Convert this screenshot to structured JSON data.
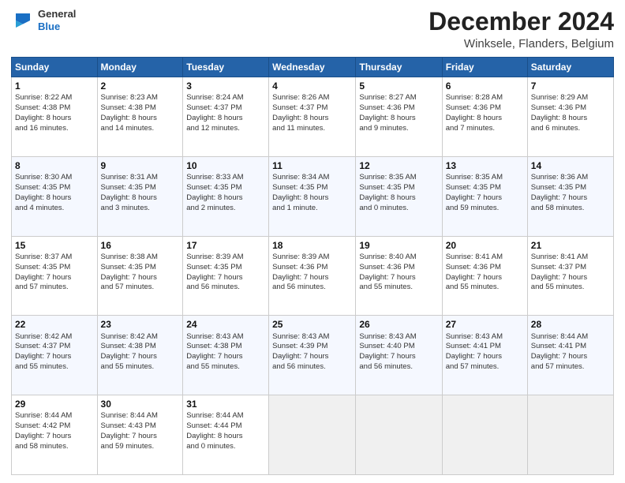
{
  "header": {
    "logo_line1": "General",
    "logo_line2": "Blue",
    "month": "December 2024",
    "location": "Winksele, Flanders, Belgium"
  },
  "days_of_week": [
    "Sunday",
    "Monday",
    "Tuesday",
    "Wednesday",
    "Thursday",
    "Friday",
    "Saturday"
  ],
  "weeks": [
    [
      {
        "num": "1",
        "lines": [
          "Sunrise: 8:22 AM",
          "Sunset: 4:38 PM",
          "Daylight: 8 hours",
          "and 16 minutes."
        ]
      },
      {
        "num": "2",
        "lines": [
          "Sunrise: 8:23 AM",
          "Sunset: 4:38 PM",
          "Daylight: 8 hours",
          "and 14 minutes."
        ]
      },
      {
        "num": "3",
        "lines": [
          "Sunrise: 8:24 AM",
          "Sunset: 4:37 PM",
          "Daylight: 8 hours",
          "and 12 minutes."
        ]
      },
      {
        "num": "4",
        "lines": [
          "Sunrise: 8:26 AM",
          "Sunset: 4:37 PM",
          "Daylight: 8 hours",
          "and 11 minutes."
        ]
      },
      {
        "num": "5",
        "lines": [
          "Sunrise: 8:27 AM",
          "Sunset: 4:36 PM",
          "Daylight: 8 hours",
          "and 9 minutes."
        ]
      },
      {
        "num": "6",
        "lines": [
          "Sunrise: 8:28 AM",
          "Sunset: 4:36 PM",
          "Daylight: 8 hours",
          "and 7 minutes."
        ]
      },
      {
        "num": "7",
        "lines": [
          "Sunrise: 8:29 AM",
          "Sunset: 4:36 PM",
          "Daylight: 8 hours",
          "and 6 minutes."
        ]
      }
    ],
    [
      {
        "num": "8",
        "lines": [
          "Sunrise: 8:30 AM",
          "Sunset: 4:35 PM",
          "Daylight: 8 hours",
          "and 4 minutes."
        ]
      },
      {
        "num": "9",
        "lines": [
          "Sunrise: 8:31 AM",
          "Sunset: 4:35 PM",
          "Daylight: 8 hours",
          "and 3 minutes."
        ]
      },
      {
        "num": "10",
        "lines": [
          "Sunrise: 8:33 AM",
          "Sunset: 4:35 PM",
          "Daylight: 8 hours",
          "and 2 minutes."
        ]
      },
      {
        "num": "11",
        "lines": [
          "Sunrise: 8:34 AM",
          "Sunset: 4:35 PM",
          "Daylight: 8 hours",
          "and 1 minute."
        ]
      },
      {
        "num": "12",
        "lines": [
          "Sunrise: 8:35 AM",
          "Sunset: 4:35 PM",
          "Daylight: 8 hours",
          "and 0 minutes."
        ]
      },
      {
        "num": "13",
        "lines": [
          "Sunrise: 8:35 AM",
          "Sunset: 4:35 PM",
          "Daylight: 7 hours",
          "and 59 minutes."
        ]
      },
      {
        "num": "14",
        "lines": [
          "Sunrise: 8:36 AM",
          "Sunset: 4:35 PM",
          "Daylight: 7 hours",
          "and 58 minutes."
        ]
      }
    ],
    [
      {
        "num": "15",
        "lines": [
          "Sunrise: 8:37 AM",
          "Sunset: 4:35 PM",
          "Daylight: 7 hours",
          "and 57 minutes."
        ]
      },
      {
        "num": "16",
        "lines": [
          "Sunrise: 8:38 AM",
          "Sunset: 4:35 PM",
          "Daylight: 7 hours",
          "and 57 minutes."
        ]
      },
      {
        "num": "17",
        "lines": [
          "Sunrise: 8:39 AM",
          "Sunset: 4:35 PM",
          "Daylight: 7 hours",
          "and 56 minutes."
        ]
      },
      {
        "num": "18",
        "lines": [
          "Sunrise: 8:39 AM",
          "Sunset: 4:36 PM",
          "Daylight: 7 hours",
          "and 56 minutes."
        ]
      },
      {
        "num": "19",
        "lines": [
          "Sunrise: 8:40 AM",
          "Sunset: 4:36 PM",
          "Daylight: 7 hours",
          "and 55 minutes."
        ]
      },
      {
        "num": "20",
        "lines": [
          "Sunrise: 8:41 AM",
          "Sunset: 4:36 PM",
          "Daylight: 7 hours",
          "and 55 minutes."
        ]
      },
      {
        "num": "21",
        "lines": [
          "Sunrise: 8:41 AM",
          "Sunset: 4:37 PM",
          "Daylight: 7 hours",
          "and 55 minutes."
        ]
      }
    ],
    [
      {
        "num": "22",
        "lines": [
          "Sunrise: 8:42 AM",
          "Sunset: 4:37 PM",
          "Daylight: 7 hours",
          "and 55 minutes."
        ]
      },
      {
        "num": "23",
        "lines": [
          "Sunrise: 8:42 AM",
          "Sunset: 4:38 PM",
          "Daylight: 7 hours",
          "and 55 minutes."
        ]
      },
      {
        "num": "24",
        "lines": [
          "Sunrise: 8:43 AM",
          "Sunset: 4:38 PM",
          "Daylight: 7 hours",
          "and 55 minutes."
        ]
      },
      {
        "num": "25",
        "lines": [
          "Sunrise: 8:43 AM",
          "Sunset: 4:39 PM",
          "Daylight: 7 hours",
          "and 56 minutes."
        ]
      },
      {
        "num": "26",
        "lines": [
          "Sunrise: 8:43 AM",
          "Sunset: 4:40 PM",
          "Daylight: 7 hours",
          "and 56 minutes."
        ]
      },
      {
        "num": "27",
        "lines": [
          "Sunrise: 8:43 AM",
          "Sunset: 4:41 PM",
          "Daylight: 7 hours",
          "and 57 minutes."
        ]
      },
      {
        "num": "28",
        "lines": [
          "Sunrise: 8:44 AM",
          "Sunset: 4:41 PM",
          "Daylight: 7 hours",
          "and 57 minutes."
        ]
      }
    ],
    [
      {
        "num": "29",
        "lines": [
          "Sunrise: 8:44 AM",
          "Sunset: 4:42 PM",
          "Daylight: 7 hours",
          "and 58 minutes."
        ]
      },
      {
        "num": "30",
        "lines": [
          "Sunrise: 8:44 AM",
          "Sunset: 4:43 PM",
          "Daylight: 7 hours",
          "and 59 minutes."
        ]
      },
      {
        "num": "31",
        "lines": [
          "Sunrise: 8:44 AM",
          "Sunset: 4:44 PM",
          "Daylight: 8 hours",
          "and 0 minutes."
        ]
      },
      null,
      null,
      null,
      null
    ]
  ]
}
